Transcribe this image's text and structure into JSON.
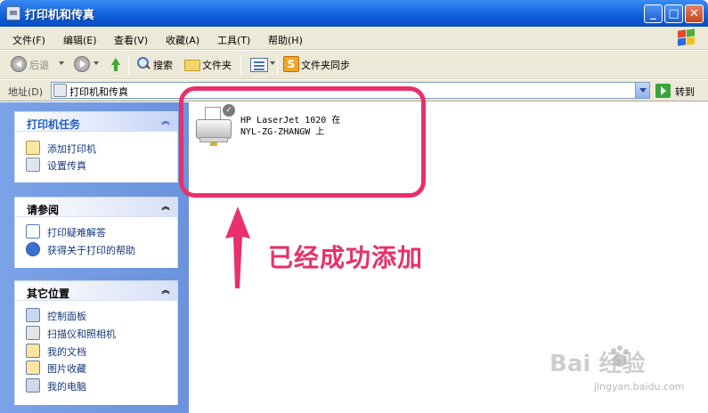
{
  "window": {
    "title": "打印机和传真"
  },
  "menu": [
    "文件(F)",
    "编辑(E)",
    "查看(V)",
    "收藏(A)",
    "工具(T)",
    "帮助(H)"
  ],
  "toolbar": {
    "back": "后退",
    "search": "搜索",
    "folders": "文件夹",
    "sync": "文件夹同步"
  },
  "address": {
    "label": "地址(D)",
    "value": "打印机和传真",
    "go": "转到"
  },
  "panels": {
    "printer_tasks": {
      "title": "打印机任务",
      "items": [
        "添加打印机",
        "设置传真"
      ]
    },
    "see_also": {
      "title": "请参阅",
      "items": [
        "打印疑难解答",
        "获得关于打印的帮助"
      ]
    },
    "other_places": {
      "title": "其它位置",
      "items": [
        "控制面板",
        "扫描仪和照相机",
        "我的文档",
        "图片收藏",
        "我的电脑"
      ]
    }
  },
  "printer": {
    "line1": "HP LaserJet 1020 在",
    "line2": "NYL-ZG-ZHANGW 上"
  },
  "annotation": {
    "text": "已经成功添加",
    "color": "#e8306a"
  },
  "watermark": {
    "main": "Bai  经验",
    "sub": "jingyan.baidu.com"
  },
  "colors": {
    "title_bar": "#0a58d6",
    "task_pane": "#6b93dd",
    "link": "#16387c"
  }
}
